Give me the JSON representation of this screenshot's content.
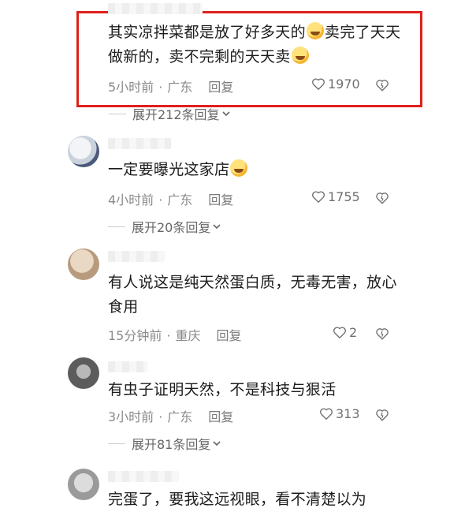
{
  "comments": [
    {
      "text_a": "其实凉拌菜都是放了好多天的",
      "text_b": "卖完了天天做新的，卖不完剩的天天卖",
      "time": "5小时前",
      "location": "广东",
      "reply_label": "回复",
      "likes": "1970",
      "expand_label": "展开212条回复"
    },
    {
      "text_a": "一定要曝光这家店",
      "time": "4小时前",
      "location": "广东",
      "reply_label": "回复",
      "likes": "1755",
      "expand_label": "展开20条回复"
    },
    {
      "text_a": "有人说这是纯天然蛋白质，无毒无害，放心食用",
      "time": "15分钟前",
      "location": "重庆",
      "reply_label": "回复",
      "likes": "2"
    },
    {
      "text_a": "有虫子证明天然，不是科技与狠活",
      "time": "3小时前",
      "location": "广东",
      "reply_label": "回复",
      "likes": "313",
      "expand_label": "展开81条回复"
    },
    {
      "text_a": "完蛋了，要我这远视眼，看不清楚以为"
    }
  ],
  "icons": {
    "like": "heart-outline-icon",
    "dislike": "dislike-icon",
    "expand": "chevron-down-icon"
  },
  "colors": {
    "highlight_box": "#e0201b",
    "meta_text": "#8a8a8a"
  }
}
